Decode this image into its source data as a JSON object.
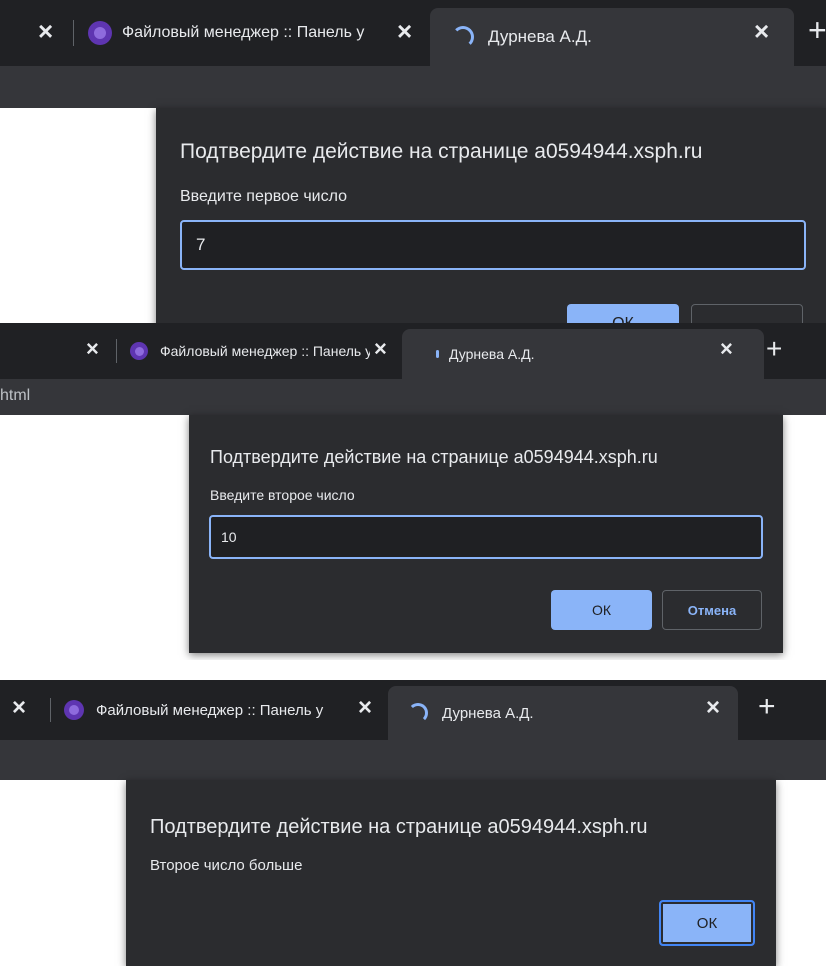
{
  "panel1": {
    "tab_file_manager": "Файловый менеджер :: Панель у",
    "tab_active": "Дурнева А.Д.",
    "dialog": {
      "title": "Подтвердите действие на странице a0594944.xsph.ru",
      "message": "Введите первое число",
      "input_value": "7",
      "ok_label": "ОК"
    }
  },
  "panel2": {
    "tab_file_manager": "Файловый менеджер :: Панель у",
    "tab_active": "Дурнева А.Д.",
    "toolbar_text": "html",
    "dialog": {
      "title": "Подтвердите действие на странице a0594944.xsph.ru",
      "message": "Введите второе число",
      "input_value": "10",
      "ok_label": "ОК",
      "cancel_label": "Отмена"
    }
  },
  "panel3": {
    "tab_file_manager": "Файловый менеджер :: Панель у",
    "tab_active": "Дурнева А.Д.",
    "dialog": {
      "title": "Подтвердите действие на странице a0594944.xsph.ru",
      "message": "Второе число больше",
      "ok_label": "ОК"
    }
  },
  "icons": {
    "close": "×",
    "new_tab": "+"
  },
  "colors": {
    "tabstrip": "#202124",
    "active_tab": "#35363a",
    "dialog": "#2b2c2f",
    "accent": "#8ab4f8"
  }
}
